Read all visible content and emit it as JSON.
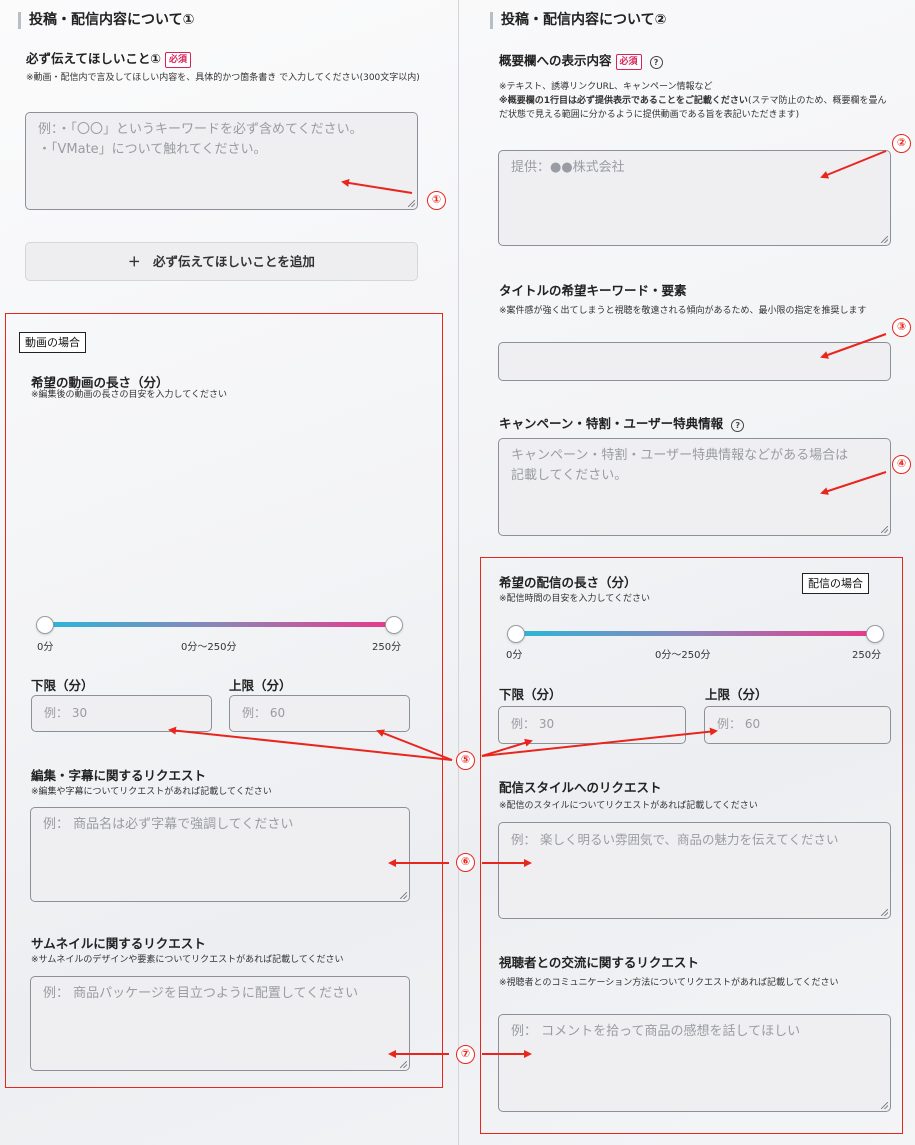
{
  "left": {
    "section_title": "投稿・配信内容について①",
    "must_convey": {
      "label": "必ず伝えてほしいこと①",
      "required": "必須",
      "note": "※動画・配信内で言及してほしい内容を、具体的かつ箇条書き で入力してください(300文字以内)",
      "placeholder_line1": "例：・「〇〇」というキーワードを必ず含めてください。",
      "placeholder_line2": "・「VMate」について触れてください。"
    },
    "add_button": "＋　必ず伝えてほしいことを追加",
    "video_case": {
      "tag": "動画の場合",
      "length_label": "希望の動画の長さ（分）",
      "length_note": "※編集後の動画の長さの目安を入力してください",
      "slider_min": "0分",
      "slider_range": "0分～250分",
      "slider_max": "250分",
      "lower_label": "下限（分）",
      "upper_label": "上限（分）",
      "lower_placeholder": "例： 30",
      "upper_placeholder": "例： 60",
      "edit_label": "編集・字幕に関するリクエスト",
      "edit_note": "※編集や字幕についてリクエストがあれば記載してください",
      "edit_placeholder": "例： 商品名は必ず字幕で強調してください",
      "thumb_label": "サムネイルに関するリクエスト",
      "thumb_note": "※サムネイルのデザインや要素についてリクエストがあれば記載してください",
      "thumb_placeholder": "例： 商品パッケージを目立つように配置してください"
    }
  },
  "right": {
    "section_title": "投稿・配信内容について②",
    "summary": {
      "label": "概要欄への表示内容",
      "required": "必須",
      "help": "?",
      "note1": "※テキスト、誘導リンクURL、キャンペーン情報など",
      "note2_bold": "※概要欄の1行目は必ず提供表示であることをご記載ください",
      "note2_rest": "(ステマ防止のため、概要欄を畳んだ状態で見える範囲に分かるように提供動画である旨を表記いただきます)",
      "placeholder": "提供：●●株式会社"
    },
    "title_kw": {
      "label": "タイトルの希望キーワード・要素",
      "note": "※案件感が強く出てしまうと視聴を敬遠される傾向があるため、最小限の指定を推奨します",
      "placeholder": ""
    },
    "campaign": {
      "label": "キャンペーン・特割・ユーザー特典情報",
      "help": "?",
      "placeholder_line1": "キャンペーン・特割・ユーザー特典情報などがある場合は",
      "placeholder_line2": "記載してください。"
    },
    "stream_case": {
      "tag": "配信の場合",
      "length_label": "希望の配信の長さ（分）",
      "length_note": "※配信時間の目安を入力してください",
      "slider_min": "0分",
      "slider_range": "0分～250分",
      "slider_max": "250分",
      "lower_label": "下限（分）",
      "upper_label": "上限（分）",
      "lower_placeholder": "例： 30",
      "upper_placeholder": "例： 60",
      "style_label": "配信スタイルへのリクエスト",
      "style_note": "※配信のスタイルについてリクエストがあれば記載してください",
      "style_placeholder": "例： 楽しく明るい雰囲気で、商品の魅力を伝えてください",
      "viewer_label": "視聴者との交流に関するリクエスト",
      "viewer_note": "※視聴者とのコミュニケーション方法についてリクエストがあれば記載してください",
      "viewer_placeholder": "例： コメントを拾って商品の感想を話してほしい"
    }
  },
  "annotations": {
    "n1": "①",
    "n2": "②",
    "n3": "③",
    "n4": "④",
    "n5": "⑤",
    "n6": "⑥",
    "n7": "⑦",
    "color": "#e8261e"
  }
}
